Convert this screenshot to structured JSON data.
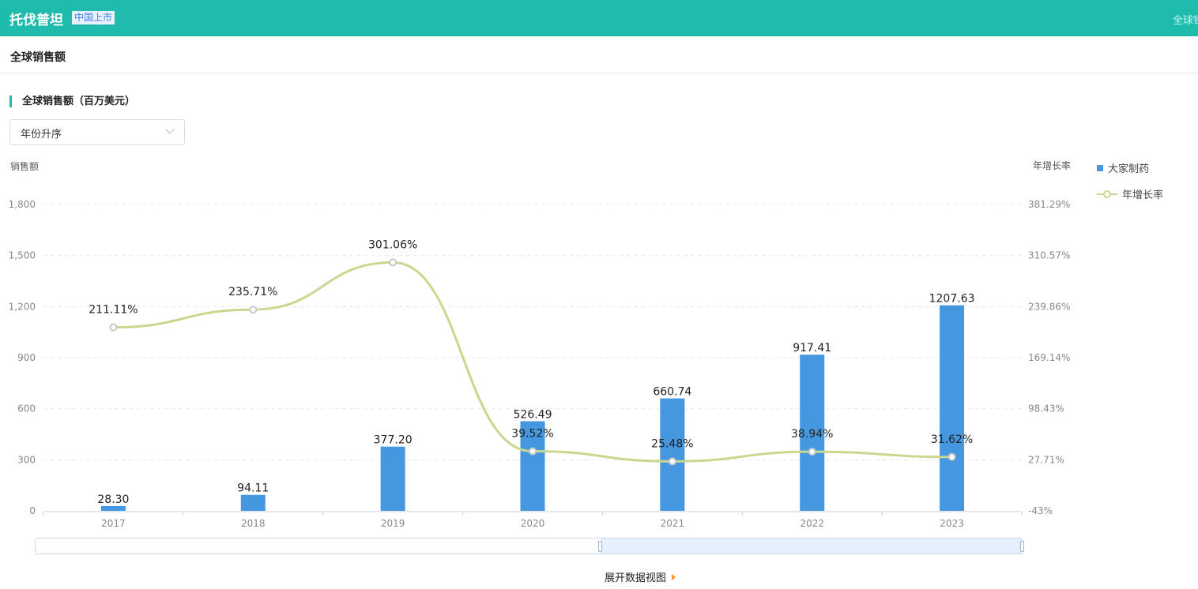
{
  "header": {
    "title": "托伐普坦",
    "badge": "中国上市",
    "right_link": "全球销售额"
  },
  "subheader": {
    "title": "全球销售额"
  },
  "section": {
    "title": "全球销售额（百万美元）"
  },
  "sort_select": {
    "value": "年份升序"
  },
  "expand_link": "展开数据视图",
  "colors": {
    "bar": "#4597e0",
    "line": "#c9d88e",
    "accent": "#1fbcae"
  },
  "chart_data": {
    "type": "bar+line",
    "categories": [
      "2017",
      "2018",
      "2019",
      "2020",
      "2021",
      "2022",
      "2023"
    ],
    "left_axis": {
      "label": "销售额",
      "range": [
        0,
        1800
      ],
      "ticks": [
        "0",
        "300",
        "600",
        "900",
        "1,200",
        "1,500",
        "1,800"
      ]
    },
    "right_axis": {
      "label": "年增长率",
      "range": [
        -43,
        381.29
      ],
      "ticks": [
        "-43%",
        "27.71%",
        "98.43%",
        "169.14%",
        "239.86%",
        "310.57%",
        "381.29%"
      ]
    },
    "series": [
      {
        "name": "大家制药",
        "type": "bar",
        "values": [
          28.3,
          94.11,
          377.2,
          526.49,
          660.74,
          917.41,
          1207.63
        ],
        "labels": [
          "28.30",
          "94.11",
          "377.20",
          "526.49",
          "660.74",
          "917.41",
          "1207.63"
        ]
      },
      {
        "name": "年增长率",
        "type": "line",
        "smooth": true,
        "values": [
          211.11,
          235.71,
          301.06,
          39.52,
          25.48,
          38.94,
          31.62
        ],
        "labels": [
          "211.11%",
          "235.71%",
          "301.06%",
          "39.52%",
          "25.48%",
          "38.94%",
          "31.62%"
        ]
      }
    ],
    "grid": "horizontal dashed",
    "legend": "right"
  }
}
